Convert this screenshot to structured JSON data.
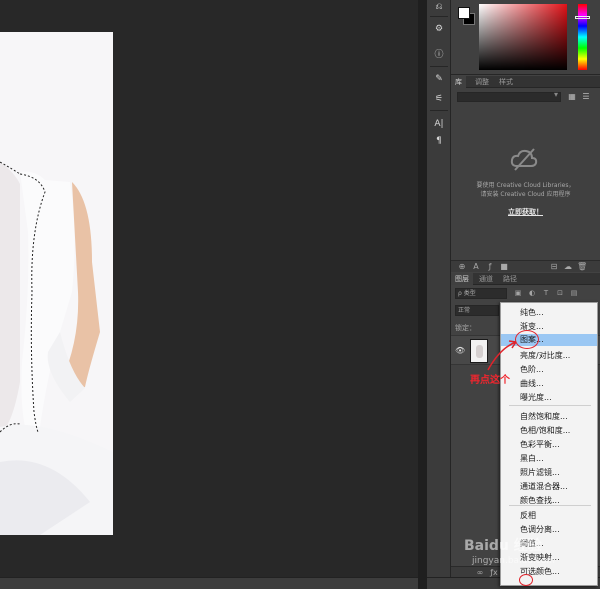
{
  "color_panel": {
    "foreground": "#ffffff",
    "background": "#000000",
    "hue": "#e01218"
  },
  "library": {
    "tabs": [
      "库",
      "调整",
      "样式"
    ],
    "message_line1": "要使用 Creative Cloud Libraries，",
    "message_line2": "请安装 Creative Cloud 应用程序",
    "link": "立即获取！"
  },
  "layers": {
    "tabs": [
      "图层",
      "通道",
      "路径"
    ],
    "filter_kind": "ρ 类型",
    "blend_mode": "正常",
    "lock_label": "锁定："
  },
  "adjustment_menu": {
    "items": [
      "纯色...",
      "渐变...",
      "图案...",
      "亮度/对比度...",
      "色阶...",
      "曲线...",
      "曝光度...",
      "自然饱和度...",
      "色相/饱和度...",
      "色彩平衡...",
      "黑白...",
      "照片滤镜...",
      "通道混合器...",
      "颜色查找...",
      "反相",
      "色调分离...",
      "阈值...",
      "渐变映射...",
      "可选颜色..."
    ],
    "selected": "图案..."
  },
  "annotation": {
    "text": "再点这个",
    "color": "#e0232b"
  },
  "watermark": {
    "brand": "Baidu 经验",
    "url": "jingyan.baidu.com"
  }
}
